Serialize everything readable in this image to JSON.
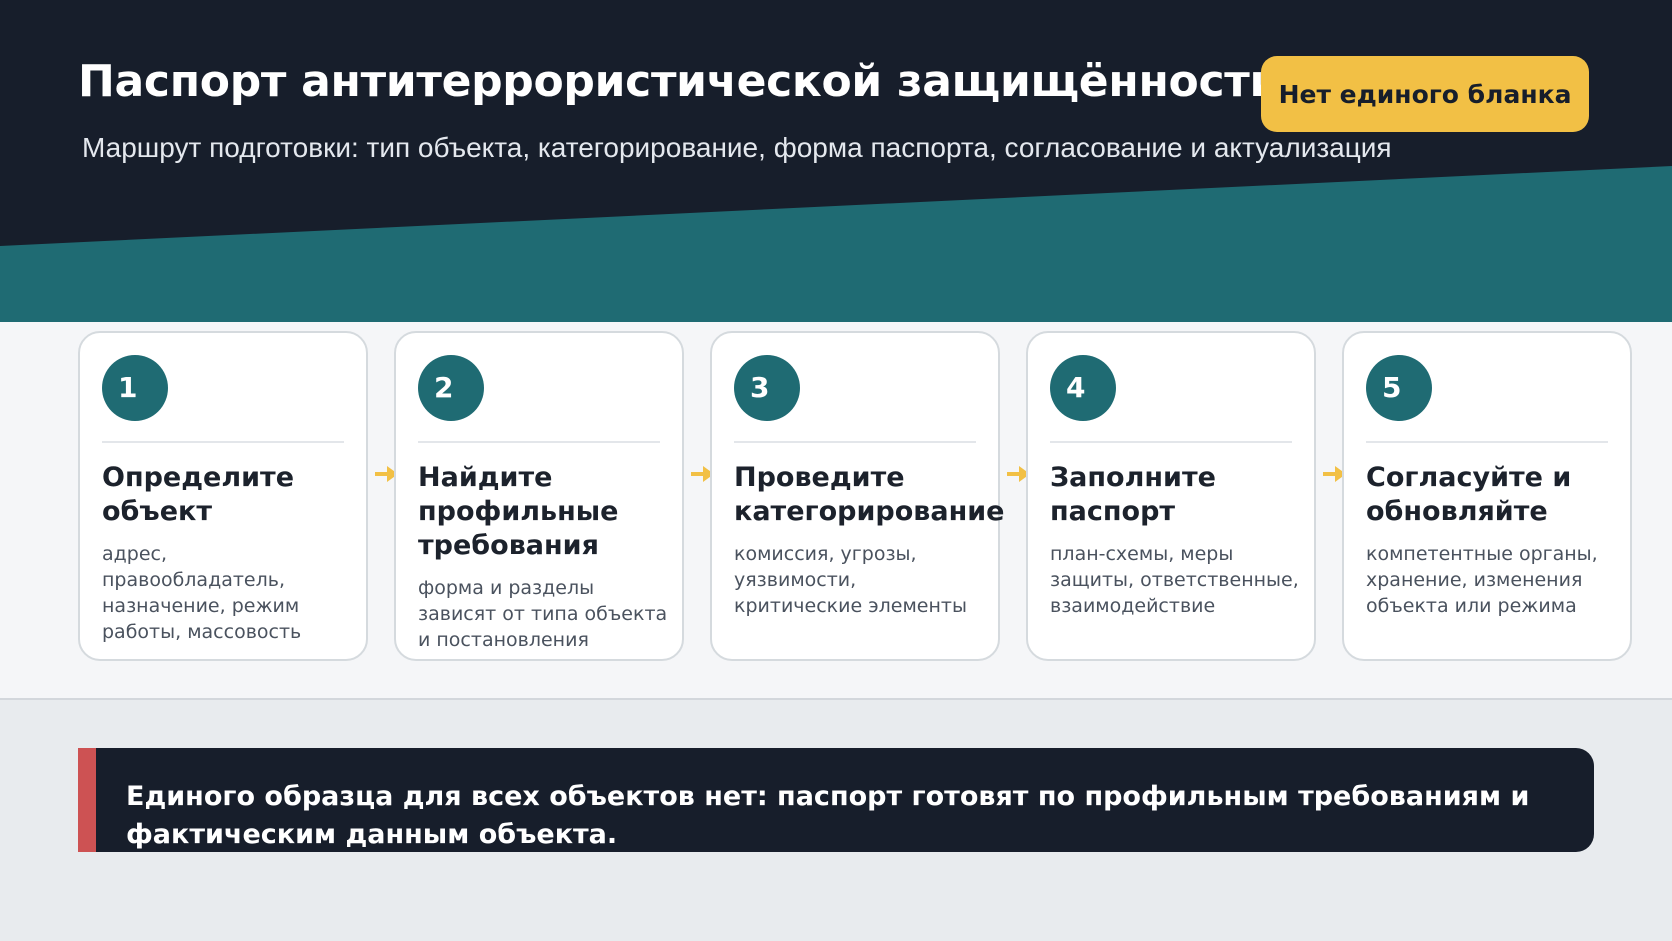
{
  "header": {
    "title": "Паспорт антитеррористической защищённости",
    "subtitle": "Маршрут подготовки: тип объекта, категорирование, форма паспорта, согласование и актуализация",
    "badge": "Нет единого бланка"
  },
  "steps": [
    {
      "number": "1",
      "title": "Определите объект",
      "description": "адрес, правообладатель, назначение, режим работы, массовость"
    },
    {
      "number": "2",
      "title": "Найдите профильные требования",
      "description": "форма и разделы зависят от типа объекта и постановления"
    },
    {
      "number": "3",
      "title": "Проведите категорирование",
      "description": "комиссия, угрозы, уязвимости, критические элементы"
    },
    {
      "number": "4",
      "title": "Заполните паспорт",
      "description": "план-схемы, меры защиты, ответственные, взаимодействие"
    },
    {
      "number": "5",
      "title": "Согласуйте и обновляйте",
      "description": "компетентные органы, хранение, изменения объекта или режима"
    }
  ],
  "callout": {
    "text": "Единого образца для всех объектов нет: паспорт готовят по профильным требованиям и фактическим данным объекта."
  },
  "colors": {
    "header_bg": "#171e2b",
    "teal": "#1f6b73",
    "badge": "#f2c045",
    "accent_red": "#cd5253",
    "arrow": "#f2c045"
  }
}
